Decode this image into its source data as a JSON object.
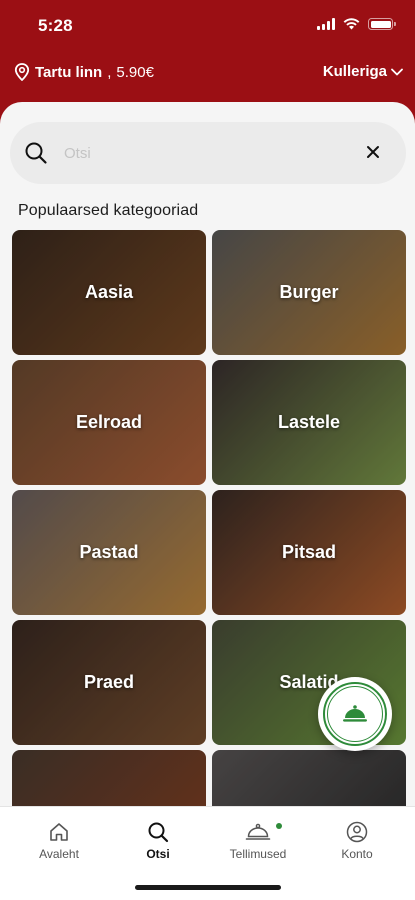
{
  "status_bar": {
    "time": "5:28"
  },
  "header": {
    "location_name": "Tartu linn",
    "delivery_fee": "5.90€",
    "delivery_mode": "Kulleriga"
  },
  "search": {
    "placeholder": "Otsi",
    "value": ""
  },
  "section_title": "Populaarsed kategooriad",
  "categories": [
    {
      "label": "Aasia",
      "colors": [
        "#3b2a1e",
        "#7a4a24"
      ]
    },
    {
      "label": "Burger",
      "colors": [
        "#5a5a5a",
        "#b07a34"
      ]
    },
    {
      "label": "Eelroad",
      "colors": [
        "#6b4a30",
        "#b2623a"
      ]
    },
    {
      "label": "Lastele",
      "colors": [
        "#3a3030",
        "#7d9a4a"
      ]
    },
    {
      "label": "Pastad",
      "colors": [
        "#6a6060",
        "#c0883e"
      ]
    },
    {
      "label": "Pitsad",
      "colors": [
        "#3a2c26",
        "#b5602e"
      ]
    },
    {
      "label": "Praed",
      "colors": [
        "#3a2a22",
        "#7a5030"
      ]
    },
    {
      "label": "Salatid",
      "colors": [
        "#4a4e3a",
        "#6f9a3e"
      ]
    },
    {
      "label": "",
      "colors": [
        "#4a3a30",
        "#8a4020"
      ]
    },
    {
      "label": "",
      "colors": [
        "#5a5656",
        "#2a2a2a"
      ]
    }
  ],
  "tabs": [
    {
      "label": "Avaleht",
      "icon": "home-icon"
    },
    {
      "label": "Otsi",
      "icon": "search-icon"
    },
    {
      "label": "Tellimused",
      "icon": "cloche-icon"
    },
    {
      "label": "Konto",
      "icon": "account-icon"
    }
  ],
  "colors": {
    "brand": "#9b0f14",
    "accent_green": "#2e8b3a"
  }
}
